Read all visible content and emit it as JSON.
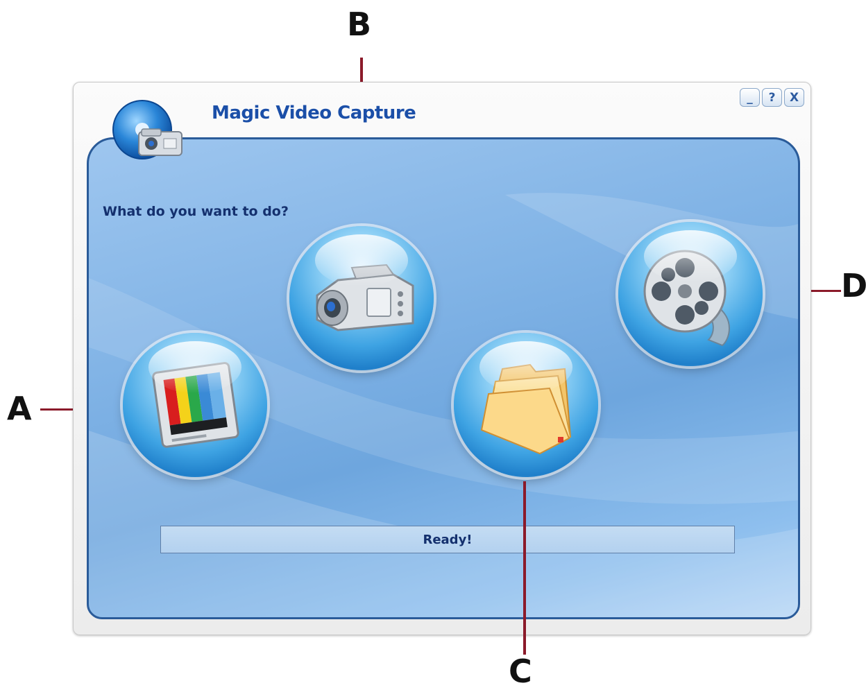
{
  "window": {
    "title": "Magic Video Capture",
    "controls": {
      "minimize": "_",
      "help": "?",
      "close": "X"
    }
  },
  "main": {
    "prompt": "What do you want to do?",
    "actions": [
      {
        "callout": "A",
        "icon": "tv-icon"
      },
      {
        "callout": "B",
        "icon": "camcorder-icon"
      },
      {
        "callout": "C",
        "icon": "folder-icon"
      },
      {
        "callout": "D",
        "icon": "film-reel-icon"
      }
    ]
  },
  "status_bar": {
    "text": "Ready!"
  },
  "colors": {
    "accent": "#1b4fa8",
    "panel_border": "#2a5b99",
    "callout_line": "#8b1a2a"
  }
}
